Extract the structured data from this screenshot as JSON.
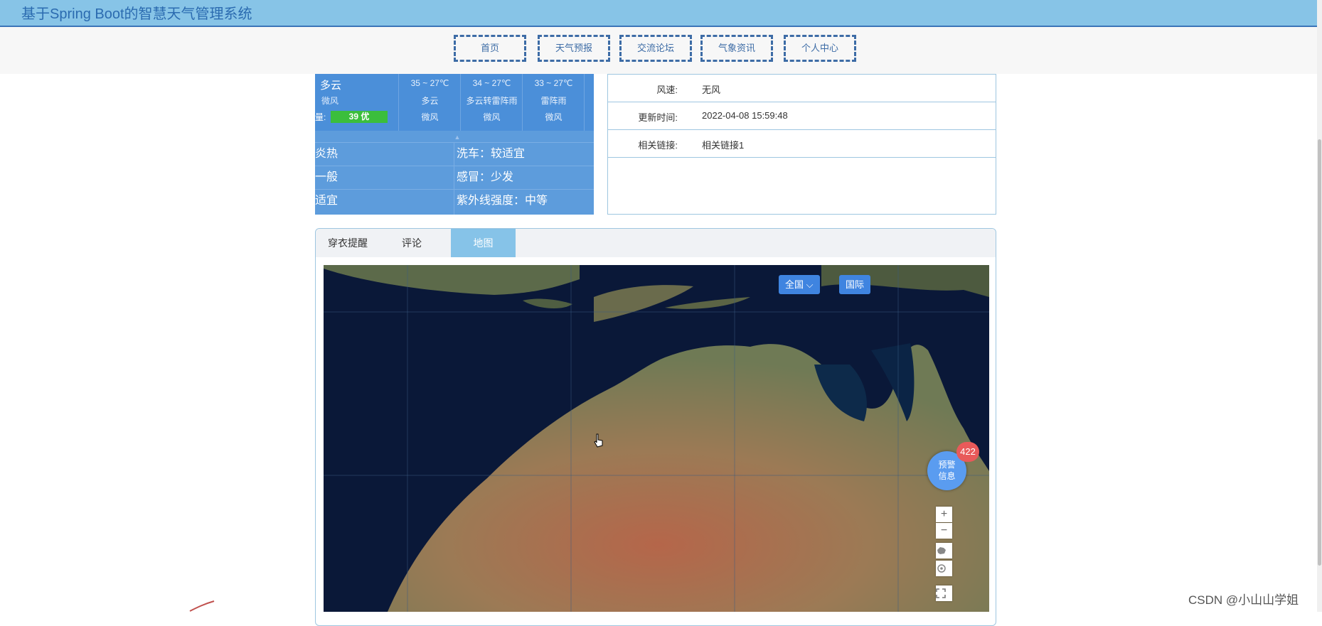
{
  "header": {
    "title": "基于Spring Boot的智慧天气管理系统"
  },
  "nav": [
    "首页",
    "天气预报",
    "交流论坛",
    "气象资讯",
    "个人中心"
  ],
  "weather": {
    "today": {
      "condition": "多云",
      "wind": "微风",
      "aqi_label": "量:",
      "aqi_value": "39 优"
    },
    "days": [
      {
        "temp": "35 ~ 27℃",
        "cond": "多云",
        "wind": "微风"
      },
      {
        "temp": "34 ~ 27℃",
        "cond": "多云转雷阵雨",
        "wind": "微风"
      },
      {
        "temp": "33 ~ 27℃",
        "cond": "雷阵雨",
        "wind": "微风"
      }
    ],
    "life_left": [
      "炎热",
      "一般",
      "适宜"
    ],
    "life_right": [
      "洗车：较适宜",
      "感冒：少发",
      "紫外线强度：中等"
    ]
  },
  "info": {
    "rows": [
      {
        "label": "风速:",
        "value": "无风"
      },
      {
        "label": "更新时间:",
        "value": "2022-04-08 15:59:48"
      },
      {
        "label": "相关链接:",
        "value": "相关链接1"
      }
    ]
  },
  "tabs": [
    "穿衣提醒",
    "评论",
    "地图"
  ],
  "map": {
    "region_select": "全国",
    "intl_button": "国际",
    "warning_label_1": "预警",
    "warning_label_2": "信息",
    "warning_count": "422",
    "zoom_in": "+",
    "zoom_out": "−"
  },
  "watermark": "CSDN @小山山学姐"
}
